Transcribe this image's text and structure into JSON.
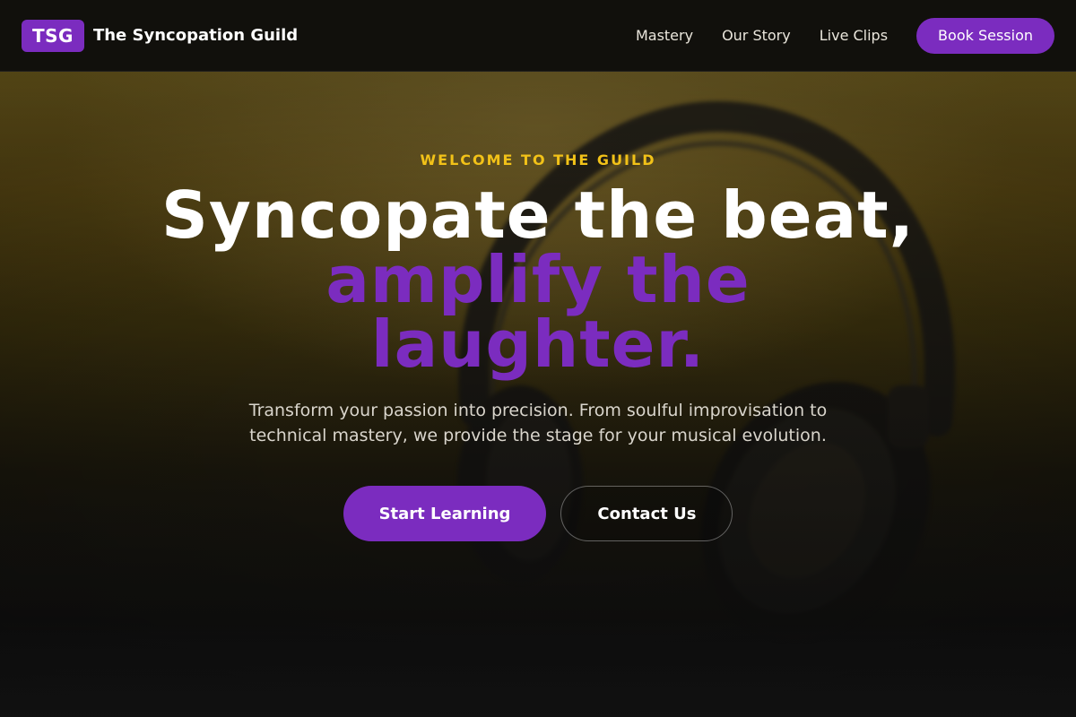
{
  "header": {
    "brand_badge": "TSG",
    "brand_name": "The Syncopation Guild",
    "nav": [
      {
        "label": "Mastery"
      },
      {
        "label": "Our Story"
      },
      {
        "label": "Live Clips"
      }
    ],
    "cta_label": "Book Session"
  },
  "hero": {
    "eyebrow": "WELCOME TO THE GUILD",
    "headline_line1": "Syncopate the beat,",
    "headline_line2": "amplify the laughter.",
    "subtitle": "Transform your passion into precision. From soulful improvisation to technical mastery, we provide the stage for your musical evolution.",
    "primary_button": "Start Learning",
    "secondary_button": "Contact Us",
    "background_image": "headphones-photo"
  },
  "colors": {
    "accent": "#7b2cbf",
    "eyebrow": "#f2c218",
    "header_bg": "#12110c",
    "page_bg": "#121212"
  }
}
